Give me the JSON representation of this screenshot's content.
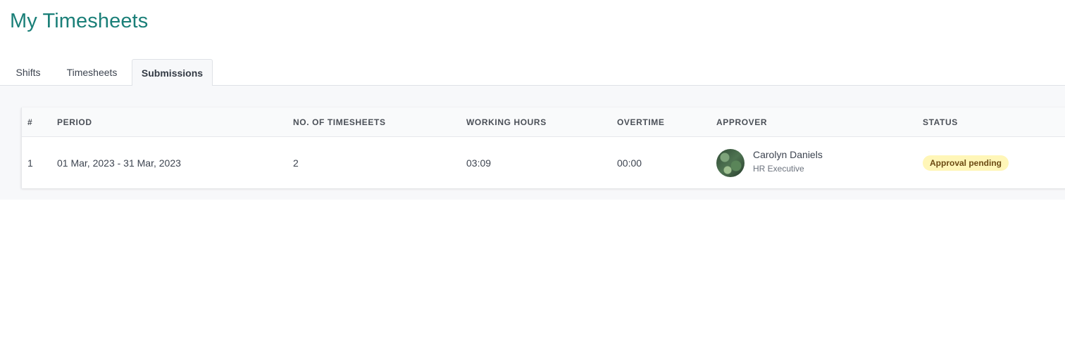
{
  "page": {
    "title": "My Timesheets"
  },
  "tabs": [
    {
      "label": "Shifts"
    },
    {
      "label": "Timesheets"
    },
    {
      "label": "Submissions",
      "active": true
    }
  ],
  "table": {
    "columns": [
      "#",
      "PERIOD",
      "NO. OF TIMESHEETS",
      "WORKING HOURS",
      "OVERTIME",
      "APPROVER",
      "STATUS"
    ],
    "rows": [
      {
        "num": "1",
        "period": "01 Mar, 2023 - 31 Mar, 2023",
        "timesheets": "2",
        "working_hours": "03:09",
        "overtime": "00:00",
        "approver": {
          "name": "Carolyn Daniels",
          "role": "HR Executive",
          "avatar_icon": "avatar-photo"
        },
        "status": "Approval pending"
      }
    ]
  },
  "colors": {
    "title": "#1a7f78",
    "badge_bg": "#fff6b8",
    "badge_text": "#6b4a12",
    "panel_bg": "#f7f8fa"
  }
}
